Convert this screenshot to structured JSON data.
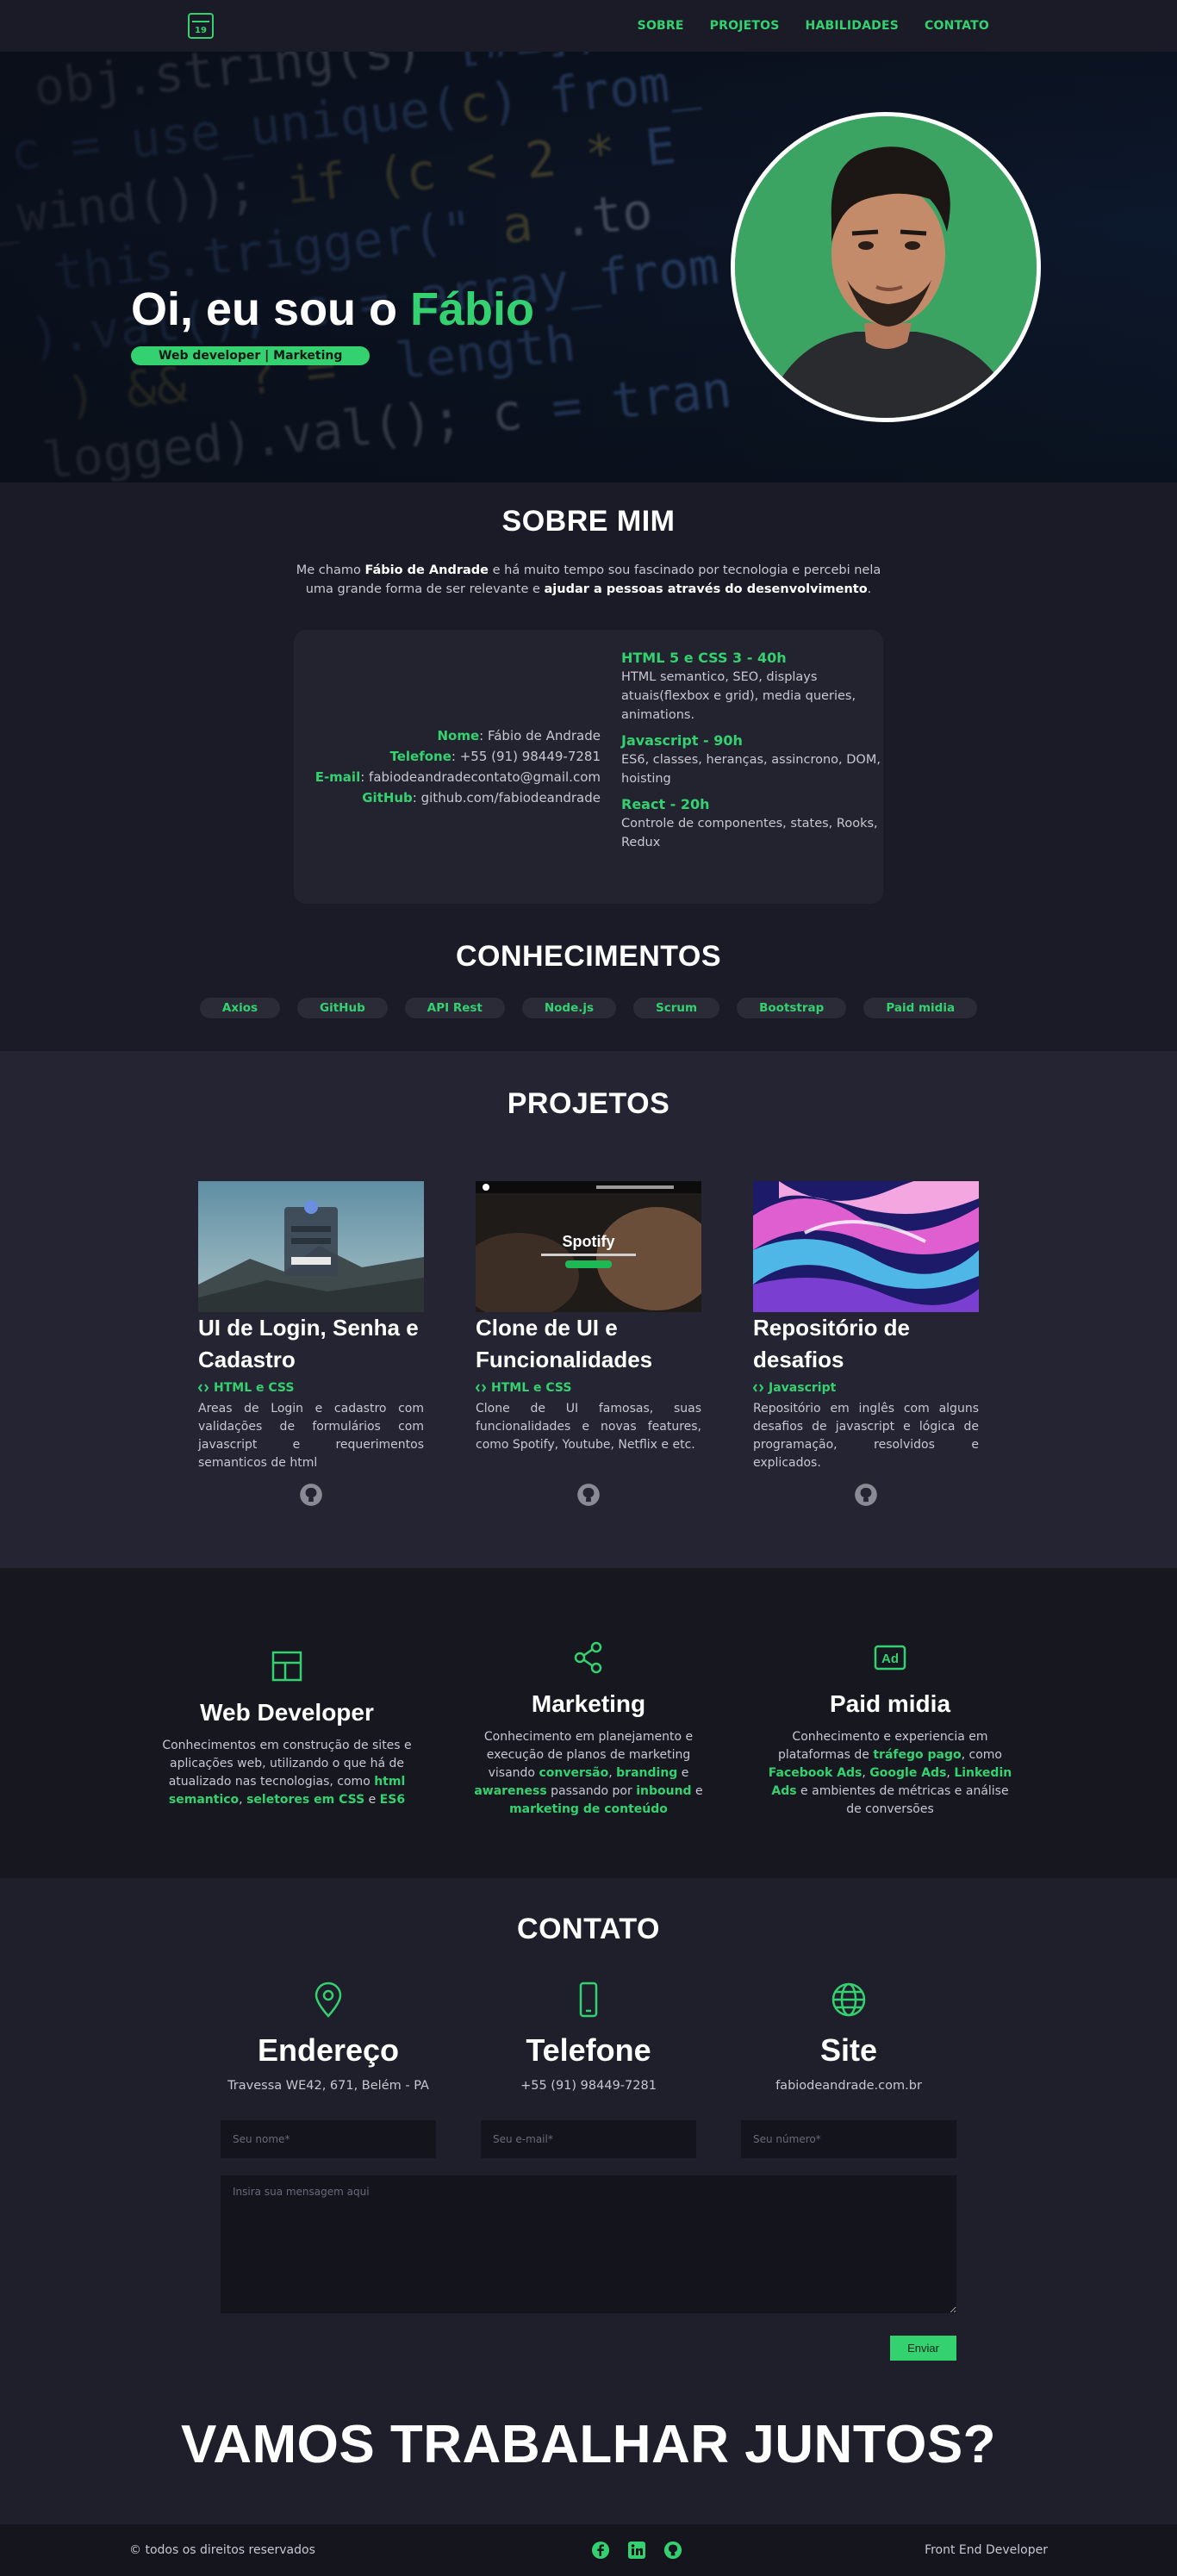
{
  "nav": {
    "logo_text": "19",
    "links": [
      "SOBRE",
      "PROJETOS",
      "HABILIDADES",
      "CONTATO"
    ]
  },
  "hero": {
    "title_prefix": "Oi, eu sou o ",
    "title_name": "Fábio",
    "badge": "Web developer | Marketing"
  },
  "about": {
    "title": "SOBRE MIM",
    "intro_1": "Me chamo ",
    "intro_name": "Fábio de Andrade",
    "intro_2": " e há muito tempo sou fascinado por tecnologia e percebi nela uma grande forma de ser relevante e ",
    "intro_bold": "ajudar a pessoas através do desenvolvimento",
    "intro_end": ".",
    "info": [
      {
        "label": "Nome",
        "value": ": Fábio de Andrade"
      },
      {
        "label": "Telefone",
        "value": ": +55 (91) 98449-7281"
      },
      {
        "label": "E-mail",
        "value": ": fabiodeandradecontato@gmail.com"
      },
      {
        "label": "GitHub",
        "value": ": github.com/fabiodeandrade"
      }
    ],
    "skills": [
      {
        "title": "HTML 5 e CSS 3 - 40h",
        "desc": "HTML semantico, SEO, displays atuais(flexbox e grid), media queries, animations."
      },
      {
        "title": "Javascript - 90h",
        "desc": "ES6, classes, heranças, assincrono, DOM, hoisting"
      },
      {
        "title": "React - 20h",
        "desc": "Controle de componentes, states, Rooks, Redux"
      }
    ]
  },
  "knowledge": {
    "title": "CONHECIMENTOS",
    "tags": [
      "Axios",
      "GitHub",
      "API Rest",
      "Node.js",
      "Scrum",
      "Bootstrap",
      "Paid midia"
    ]
  },
  "projects": {
    "title": "PROJETOS",
    "items": [
      {
        "title": "UI de Login, Senha e Cadastro",
        "tech": "HTML e CSS",
        "desc": "Areas de Login e cadastro com validações de formulários com javascript e requerimentos semanticos de html"
      },
      {
        "title": "Clone de UI e Funcionalidades",
        "tech": "HTML e CSS",
        "desc": "Clone de UI famosas, suas funcionalidades e novas features, como Spotify, Youtube, Netflix e etc."
      },
      {
        "title": "Repositório de desafios",
        "tech": "Javascript",
        "desc": "Repositório em inglês com alguns desafios de javascript e lógica de programação, resolvidos e explicados."
      }
    ],
    "spotify_label": "Spotify"
  },
  "services": [
    {
      "title": "Web Developer",
      "icon": "layout-icon",
      "parts": [
        {
          "t": "Conhecimentos em construção de sites e aplicações web, utilizando o que há de atualizado nas tecnologias, como ",
          "b": false
        },
        {
          "t": "html semantico",
          "b": true
        },
        {
          "t": ", ",
          "b": false
        },
        {
          "t": "seletores em CSS",
          "b": true
        },
        {
          "t": " e ",
          "b": false
        },
        {
          "t": "ES6",
          "b": true
        }
      ]
    },
    {
      "title": "Marketing",
      "icon": "share-icon",
      "parts": [
        {
          "t": "Conhecimento em planejamento e execução de planos de marketing visando ",
          "b": false
        },
        {
          "t": "conversão",
          "b": true
        },
        {
          "t": ", ",
          "b": false
        },
        {
          "t": "branding",
          "b": true
        },
        {
          "t": " e ",
          "b": false
        },
        {
          "t": "awareness",
          "b": true
        },
        {
          "t": " passando por ",
          "b": false
        },
        {
          "t": "inbound",
          "b": true
        },
        {
          "t": " e ",
          "b": false
        },
        {
          "t": "marketing de conteúdo",
          "b": true
        }
      ]
    },
    {
      "title": "Paid midia",
      "icon": "ad-icon",
      "parts": [
        {
          "t": "Conhecimento e experiencia em plataformas de ",
          "b": false
        },
        {
          "t": "tráfego pago",
          "b": true
        },
        {
          "t": ", como ",
          "b": false
        },
        {
          "t": "Facebook Ads",
          "b": true
        },
        {
          "t": ", ",
          "b": false
        },
        {
          "t": "Google Ads",
          "b": true
        },
        {
          "t": ", ",
          "b": false
        },
        {
          "t": "Linkedin Ads",
          "b": true
        },
        {
          "t": " e ambientes de métricas e análise de conversões",
          "b": false
        }
      ]
    }
  ],
  "contact": {
    "title": "CONTATO",
    "cols": [
      {
        "heading": "Endereço",
        "value": "Travessa WE42, 671, Belém - PA"
      },
      {
        "heading": "Telefone",
        "value": "+55 (91) 98449-7281"
      },
      {
        "heading": "Site",
        "value": "fabiodeandrade.com.br"
      }
    ],
    "form": {
      "name_placeholder": "Seu nome*",
      "email_placeholder": "Seu e-mail*",
      "phone_placeholder": "Seu número*",
      "message_placeholder": "Insira sua mensagem aqui",
      "send_label": "Enviar"
    },
    "cta": "VAMOS TRABALHAR JUNTOS?"
  },
  "footer": {
    "left": "© todos os direitos reservados",
    "right": "Front End Developer"
  },
  "colors": {
    "accent": "#33d16f",
    "background": "#1b1b27"
  }
}
